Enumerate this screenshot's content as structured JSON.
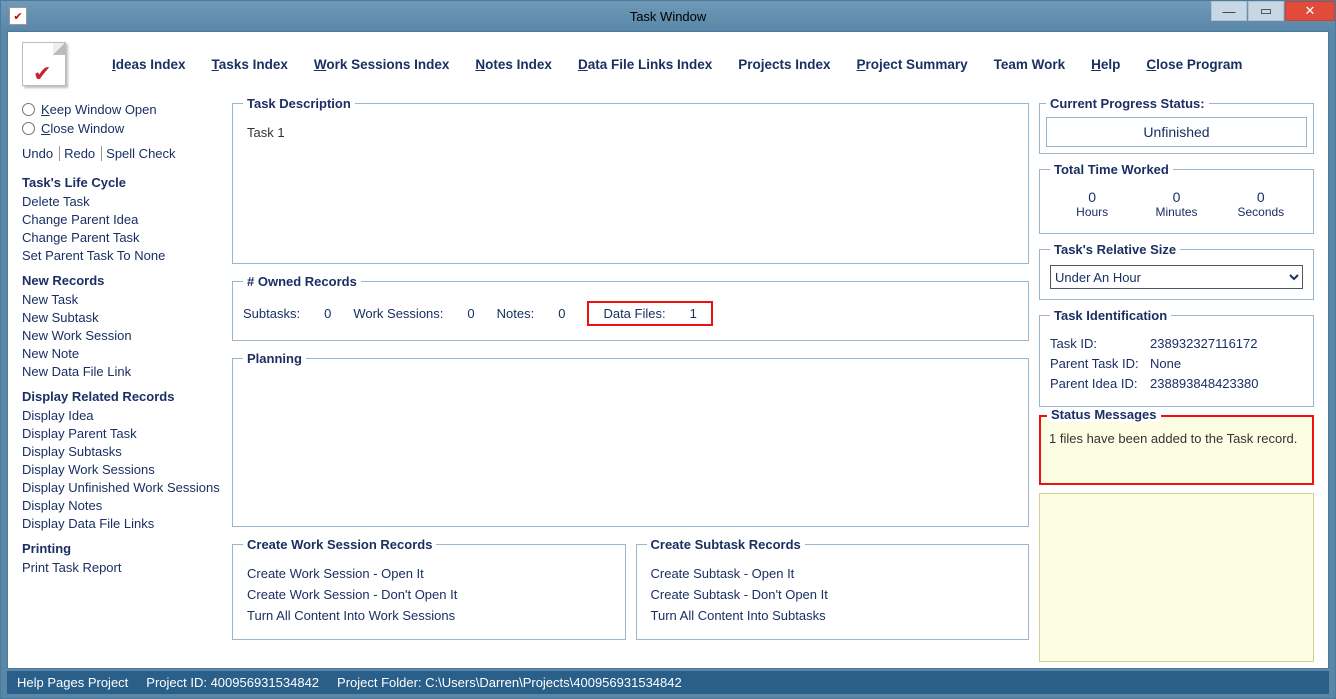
{
  "window": {
    "title": "Task Window"
  },
  "menu": {
    "ideas": "deas Index",
    "tasks": "asks Index",
    "work": "ork Sessions Index",
    "notes": "otes Index",
    "data": "ata File Links Index",
    "projects": "Projects Index",
    "summary": "roject Summary",
    "team": "Team Work",
    "help": "elp",
    "close": "lose Program"
  },
  "left": {
    "keep": "eep Window Open",
    "close": "lose Window",
    "undo": "Undo",
    "redo": "Redo",
    "spell": "Spell Check",
    "lifecycle_header": "Task's Life Cycle",
    "lifecycle": [
      "Delete Task",
      "Change Parent Idea",
      "Change Parent Task",
      "Set Parent Task To None"
    ],
    "new_header": "New Records",
    "newrec": [
      "New Task",
      "New Subtask",
      "New Work Session",
      "New Note",
      "New Data File Link"
    ],
    "disp_header": "Display Related Records",
    "disp": [
      "Display Idea",
      "Display Parent Task",
      "Display Subtasks",
      "Display Work Sessions",
      "Display Unfinished Work Sessions",
      "Display Notes",
      "Display Data File Links"
    ],
    "print_header": "Printing",
    "print": [
      "Print Task Report"
    ]
  },
  "desc": {
    "legend": "Task Description",
    "text": "Task 1"
  },
  "counts": {
    "legend": "# Owned Records",
    "subtasks_l": "Subtasks:",
    "subtasks_v": "0",
    "work_l": "Work Sessions:",
    "work_v": "0",
    "notes_l": "Notes:",
    "notes_v": "0",
    "files_l": "Data Files:",
    "files_v": "1"
  },
  "planning": {
    "legend": "Planning"
  },
  "create_ws": {
    "legend": "Create Work Session Records",
    "a1": "Create Work Session - Open It",
    "a2": "Create Work Session - Don't Open It",
    "a3": "Turn All Content Into Work Sessions"
  },
  "create_sub": {
    "legend": "Create Subtask Records",
    "a1": "Create Subtask - Open It",
    "a2": "Create Subtask - Don't Open It",
    "a3": "Turn All Content Into Subtasks"
  },
  "progress": {
    "legend": "Current Progress Status:",
    "value": "Unfinished"
  },
  "time": {
    "legend": "Total Time Worked",
    "h": "0",
    "m": "0",
    "s": "0",
    "hl": "Hours",
    "ml": "Minutes",
    "sl": "Seconds"
  },
  "relsize": {
    "legend": "Task's Relative Size",
    "value": "Under An Hour"
  },
  "ident": {
    "legend": "Task Identification",
    "task_k": "Task ID:",
    "task_v": "238932327116172",
    "pt_k": "Parent Task ID:",
    "pt_v": "None",
    "pi_k": "Parent Idea ID:",
    "pi_v": "238893848423380"
  },
  "status": {
    "legend": "Status Messages",
    "msg": "1 files have been added to the Task record."
  },
  "footer": {
    "a": "Help Pages Project",
    "b": "Project ID: 400956931534842",
    "c": "Project Folder: C:\\Users\\Darren\\Projects\\400956931534842"
  }
}
